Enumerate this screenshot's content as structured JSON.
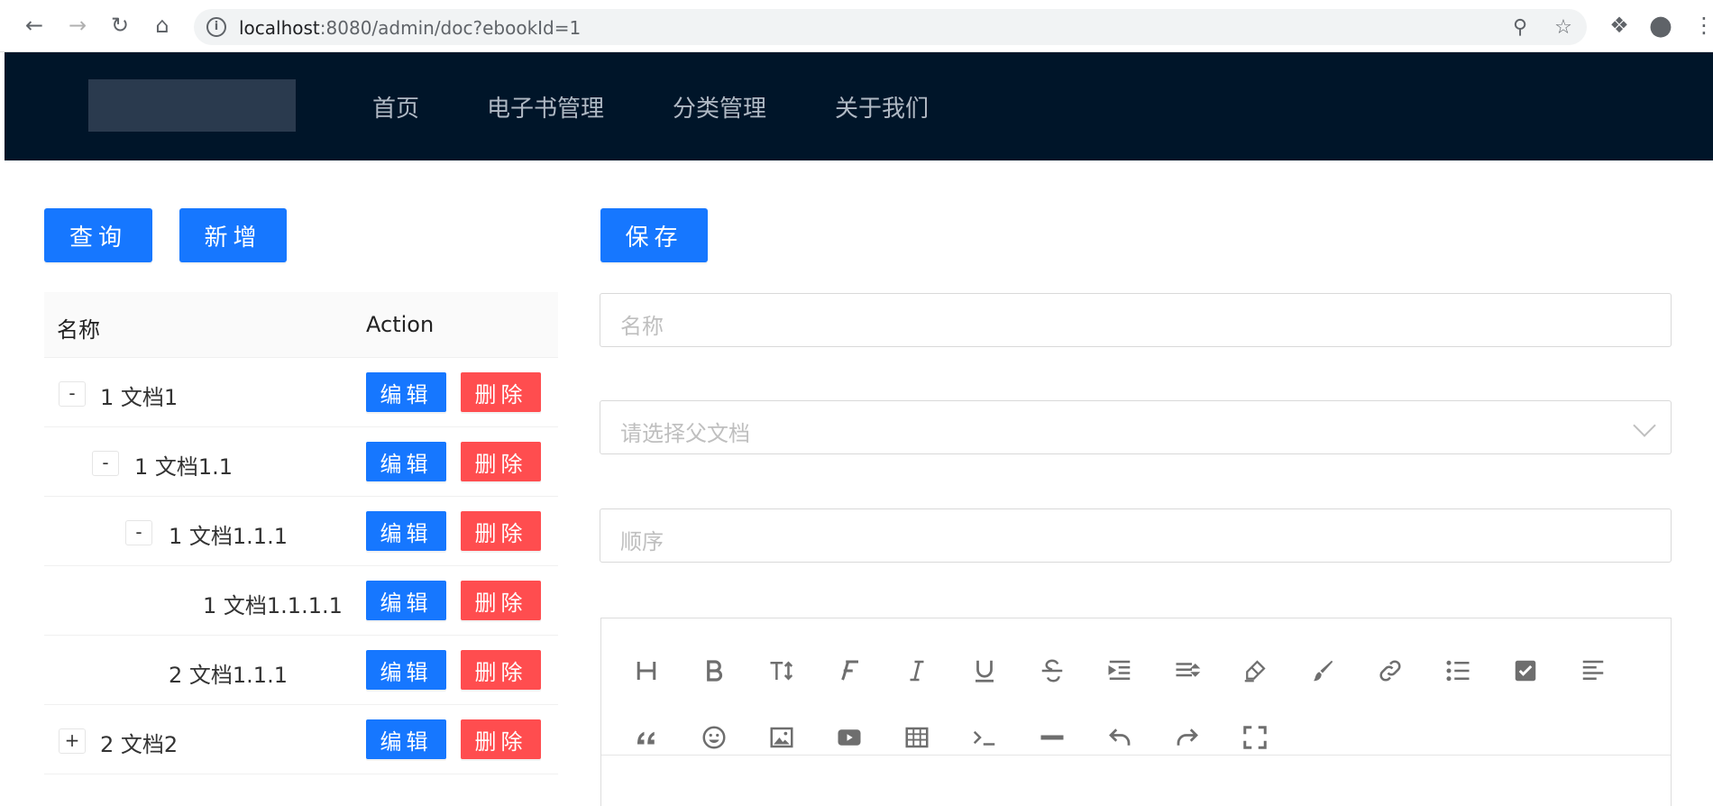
{
  "browser": {
    "url_host": "localhost",
    "url_path": ":8080/admin/doc?ebookId=1"
  },
  "header": {
    "nav": [
      "首页",
      "电子书管理",
      "分类管理",
      "关于我们"
    ]
  },
  "left": {
    "query_label": "查询",
    "add_label": "新增",
    "columns": {
      "name": "名称",
      "action": "Action"
    },
    "edit_label": "编辑",
    "delete_label": "删除",
    "rows": [
      {
        "label": "1 文档1",
        "toggle": "-"
      },
      {
        "label": "1 文档1.1",
        "toggle": "-"
      },
      {
        "label": "1 文档1.1.1",
        "toggle": "-"
      },
      {
        "label": "1 文档1.1.1.1",
        "toggle": ""
      },
      {
        "label": "2 文档1.1.1",
        "toggle": ""
      },
      {
        "label": "2 文档2",
        "toggle": "+"
      }
    ]
  },
  "form": {
    "save_label": "保存",
    "name_placeholder": "名称",
    "parent_placeholder": "请选择父文档",
    "sort_placeholder": "顺序"
  },
  "colors": {
    "primary": "#1677ff",
    "danger": "#ff4d4f",
    "header_bg": "#001529"
  }
}
